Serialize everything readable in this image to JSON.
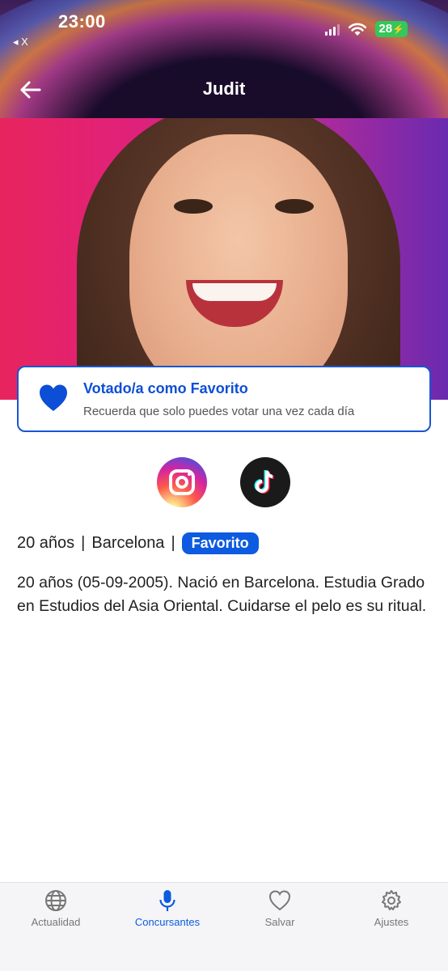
{
  "status_bar": {
    "time": "23:00",
    "back_app": "◂ X",
    "battery": "28"
  },
  "header": {
    "title": "Judit"
  },
  "vote_card": {
    "title": "Votado/a como Favorito",
    "subtitle": "Recuerda que solo puedes votar una vez cada día"
  },
  "social": {
    "icons": [
      "instagram-icon",
      "tiktok-icon"
    ]
  },
  "profile": {
    "age": "20 años",
    "separator": "|",
    "city": "Barcelona",
    "badge": "Favorito",
    "bio": "20 años (05-09-2005). Nació en Barcelona. Estudia Grado en Estudios del Asia Oriental. Cuidarse el pelo es su ritual."
  },
  "tabbar": {
    "items": [
      {
        "label": "Actualidad",
        "icon": "globe-icon",
        "active": false
      },
      {
        "label": "Concursantes",
        "icon": "microphone-icon",
        "active": true
      },
      {
        "label": "Salvar",
        "icon": "heart-icon",
        "active": false
      },
      {
        "label": "Ajustes",
        "icon": "gear-icon",
        "active": false
      }
    ]
  },
  "colors": {
    "accent": "#0d5be0",
    "battery": "#34c759"
  }
}
